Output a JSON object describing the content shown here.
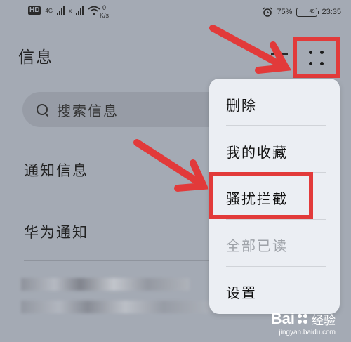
{
  "status_bar": {
    "hd": "HD",
    "sim1": "1",
    "net1": "4G",
    "net2": "x",
    "speed_value": "0",
    "speed_unit": "K/s",
    "battery_percent": "75%",
    "battery_level": "49",
    "time": "23:35"
  },
  "header": {
    "title": "信息",
    "plus_label": "+"
  },
  "search": {
    "placeholder": "搜索信息"
  },
  "list": {
    "items": [
      {
        "label": "通知信息"
      },
      {
        "label": "华为通知"
      }
    ]
  },
  "menu": {
    "items": [
      {
        "label": "删除",
        "enabled": true
      },
      {
        "label": "我的收藏",
        "enabled": true
      },
      {
        "label": "骚扰拦截",
        "enabled": true
      },
      {
        "label": "全部已读",
        "enabled": false
      },
      {
        "label": "设置",
        "enabled": true
      }
    ]
  },
  "annotation": {
    "color": "#e23a3a"
  },
  "watermark": {
    "brand": "Bai",
    "brand_suffix": "经验",
    "url": "jingyan.baidu.com"
  }
}
